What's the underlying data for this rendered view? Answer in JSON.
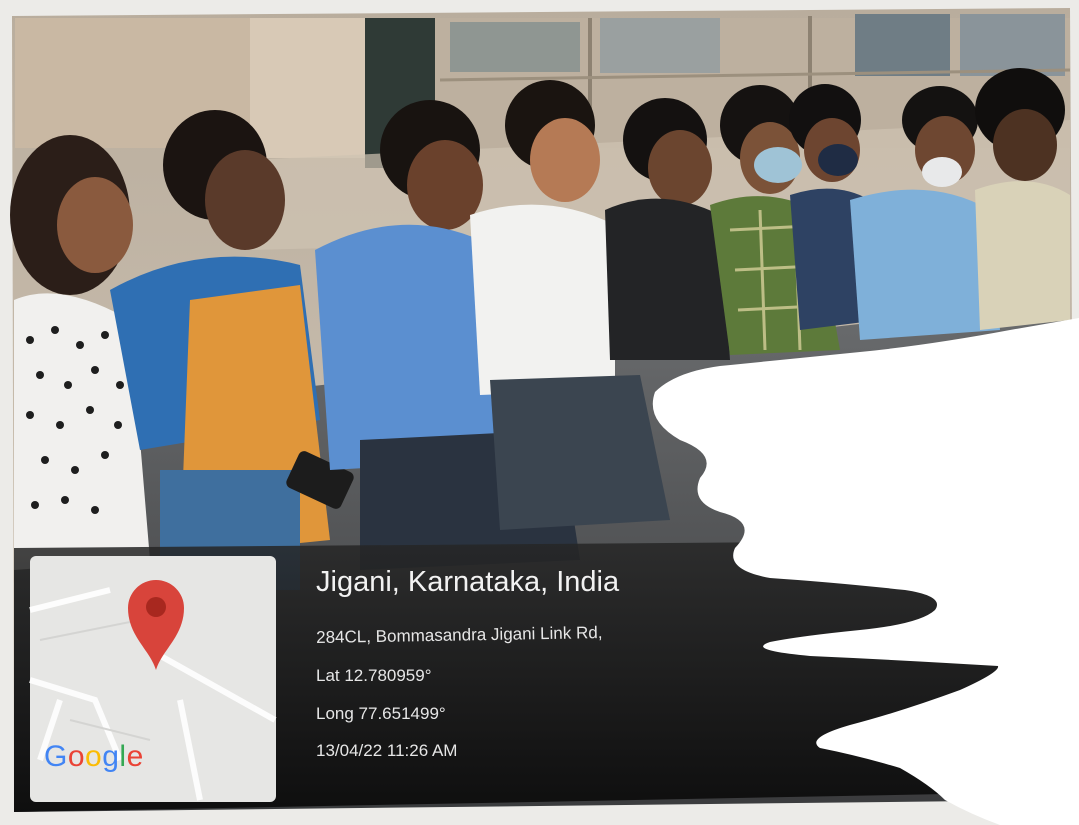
{
  "location_stamp": {
    "place": "Jigani, Karnataka, India",
    "address": "284CL, Bommasandra Jigani Link Rd,",
    "latitude": "Lat 12.780959°",
    "longitude": "Long 77.651499°",
    "datetime": "13/04/22 11:26 AM"
  },
  "map_thumbnail": {
    "pin_icon": "map-pin-icon",
    "logo_letters": [
      "G",
      "o",
      "o",
      "g",
      "l",
      "e"
    ],
    "logo_colors": [
      "#4285F4",
      "#EA4335",
      "#FBBC05",
      "#4285F4",
      "#34A853",
      "#EA4335"
    ],
    "pin_color": "#d8443b"
  },
  "photo": {
    "description_colors": {
      "wall": "#c4b7a6",
      "overlay": "#161616",
      "redaction": "#ffffff"
    }
  }
}
